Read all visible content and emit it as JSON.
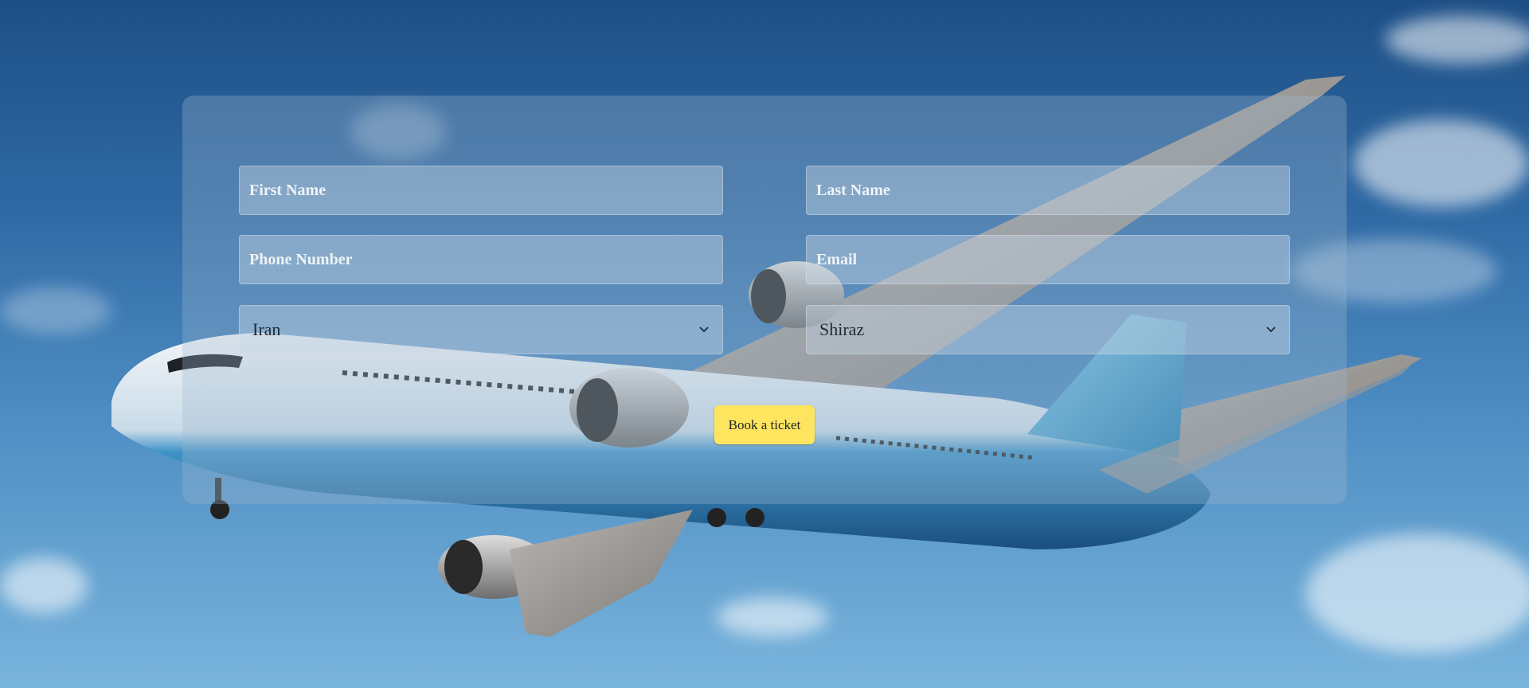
{
  "form": {
    "first_name_placeholder": "First Name",
    "last_name_placeholder": "Last Name",
    "phone_placeholder": "Phone Number",
    "email_placeholder": "Email",
    "country_selected": "Iran",
    "city_selected": "Shiraz",
    "book_label": "Book a ticket"
  },
  "colors": {
    "button": "#fde55f",
    "panel": "rgba(160,185,205,0.32)",
    "sky": "#2f69a4"
  },
  "icons": {
    "select_arrow": "chevron-down-icon"
  }
}
